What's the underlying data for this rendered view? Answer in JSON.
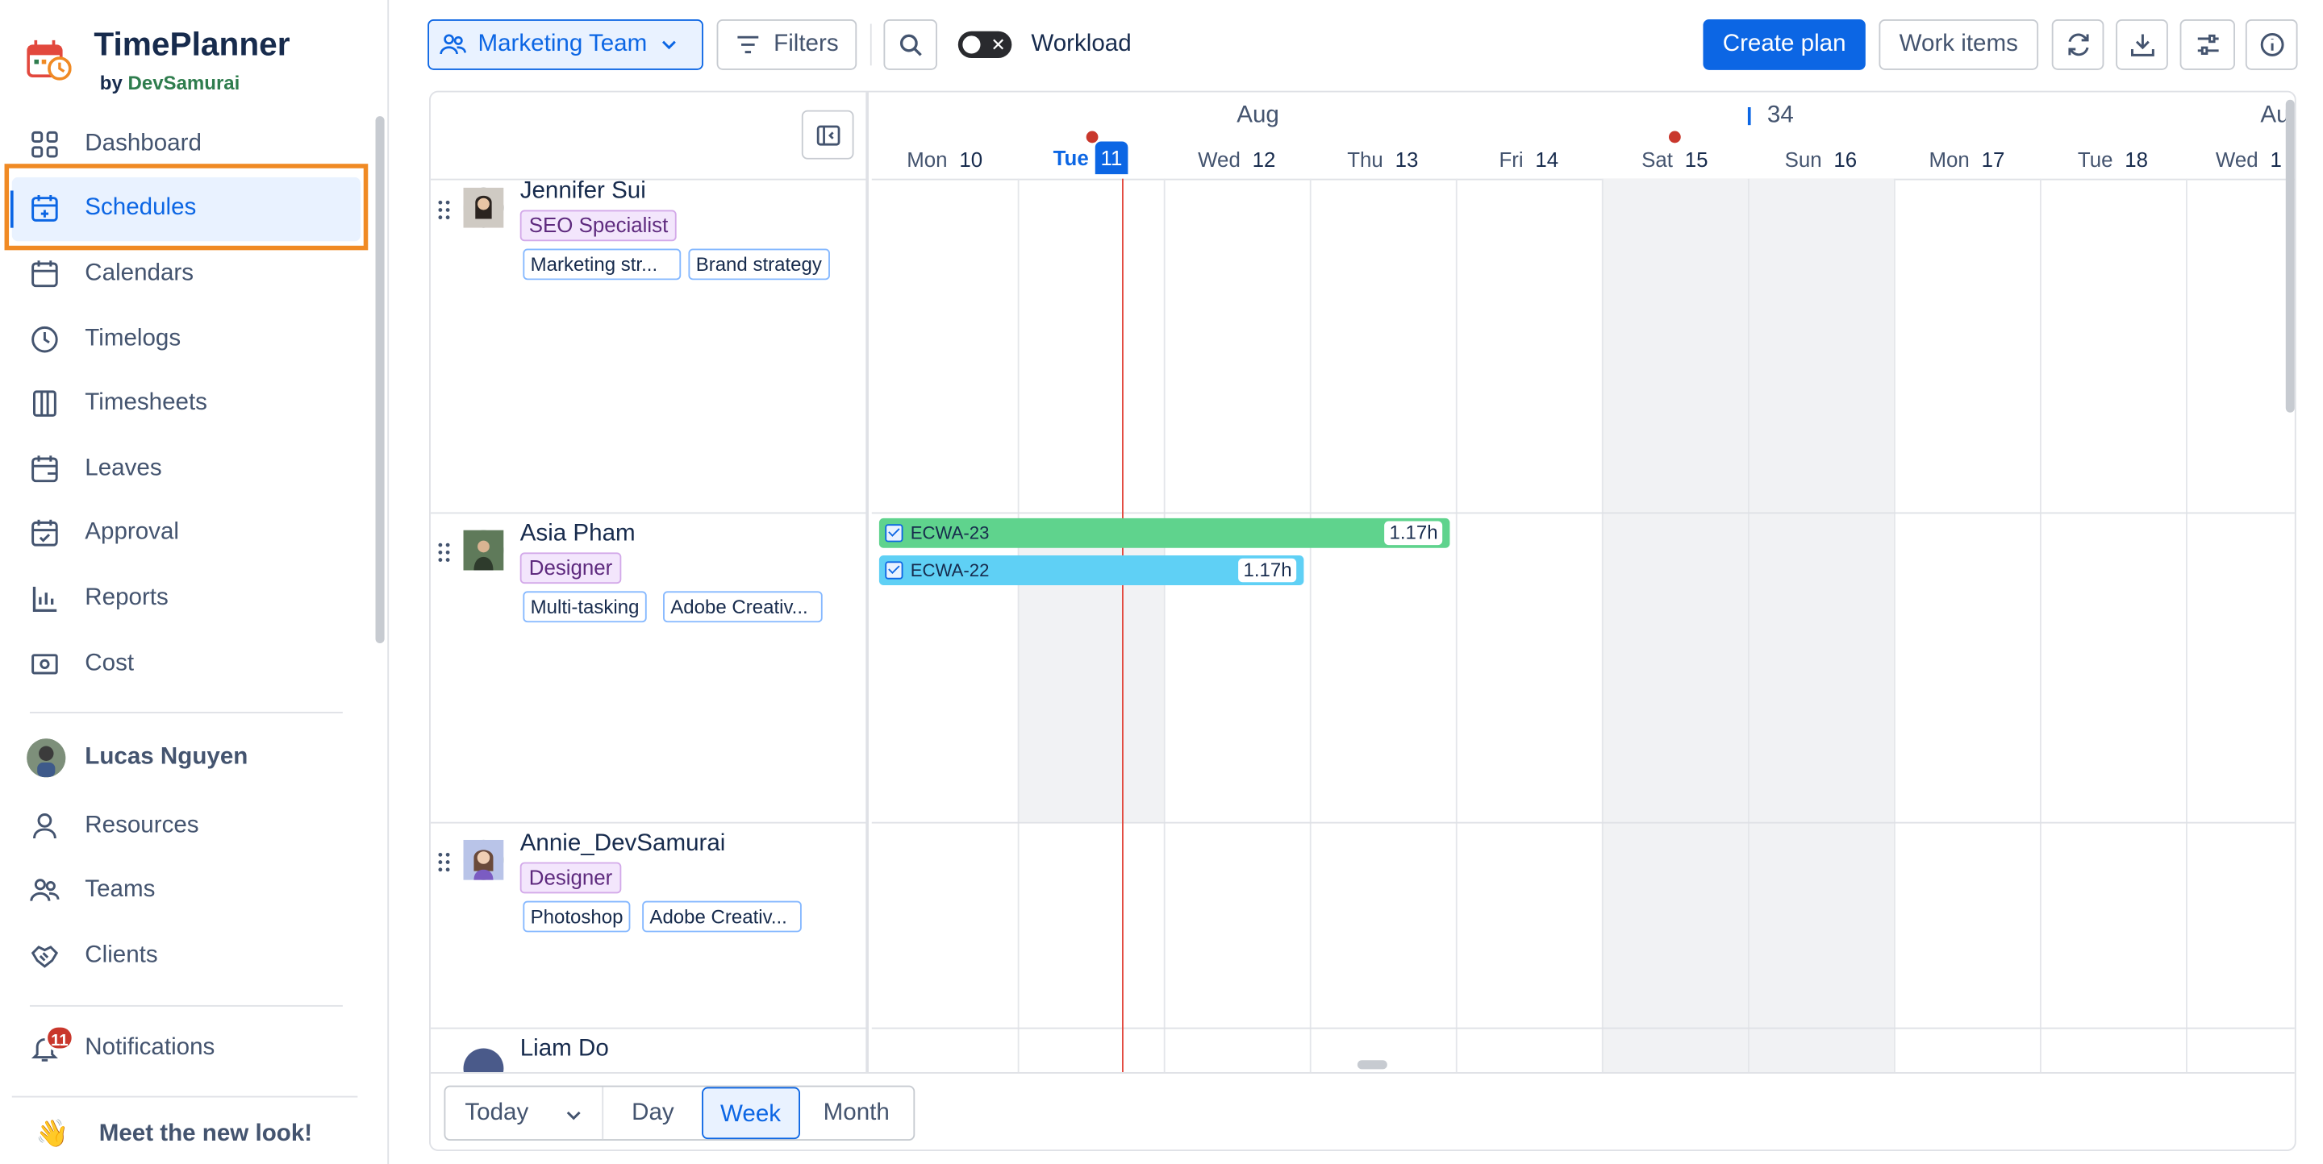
{
  "brand": {
    "name": "TimePlanner",
    "by": "by",
    "company": "DevSamurai"
  },
  "nav": {
    "dashboard": "Dashboard",
    "schedules": "Schedules",
    "calendars": "Calendars",
    "timelogs": "Timelogs",
    "timesheets": "Timesheets",
    "leaves": "Leaves",
    "approval": "Approval",
    "reports": "Reports",
    "cost": "Cost",
    "resources": "Resources",
    "teams": "Teams",
    "clients": "Clients",
    "notifications": "Notifications",
    "notification_count": "11",
    "new_look": "Meet the new look!",
    "new_look_emoji": "👋"
  },
  "user": {
    "name": "Lucas Nguyen"
  },
  "toolbar": {
    "team": "Marketing Team",
    "filters": "Filters",
    "workload": "Workload",
    "workload_on": false,
    "create_plan": "Create plan",
    "work_items": "Work items"
  },
  "timeline": {
    "month": "Aug",
    "month_next": "Au",
    "week_number": "34",
    "days": [
      {
        "name": "Mon",
        "num": "10"
      },
      {
        "name": "Tue",
        "num": "11",
        "today": true
      },
      {
        "name": "Wed",
        "num": "12"
      },
      {
        "name": "Thu",
        "num": "13"
      },
      {
        "name": "Fri",
        "num": "14"
      },
      {
        "name": "Sat",
        "num": "15"
      },
      {
        "name": "Sun",
        "num": "16"
      },
      {
        "name": "Mon",
        "num": "17"
      },
      {
        "name": "Tue",
        "num": "18"
      },
      {
        "name": "Wed",
        "num": "1"
      }
    ]
  },
  "people": [
    {
      "name": "Jennifer Sui",
      "role": "SEO Specialist",
      "skills": [
        "Marketing str...",
        "Brand strategy"
      ]
    },
    {
      "name": "Asia Pham",
      "role": "Designer",
      "skills": [
        "Multi-tasking",
        "Adobe Creativ..."
      ],
      "tasks": [
        {
          "key": "ECWA-23",
          "hours": "1.17h",
          "color": "#5fd38d"
        },
        {
          "key": "ECWA-22",
          "hours": "1.17h",
          "color": "#5fd0f5"
        }
      ]
    },
    {
      "name": "Annie_DevSamurai",
      "role": "Designer",
      "skills": [
        "Photoshop",
        "Adobe Creativ..."
      ]
    },
    {
      "name": "Liam Do"
    }
  ],
  "footer": {
    "today": "Today",
    "day": "Day",
    "week": "Week",
    "month": "Month",
    "active_view": "Week"
  },
  "colors": {
    "accent": "#0c66e4",
    "highlight": "#f08a24",
    "now_line": "#e2483d"
  }
}
